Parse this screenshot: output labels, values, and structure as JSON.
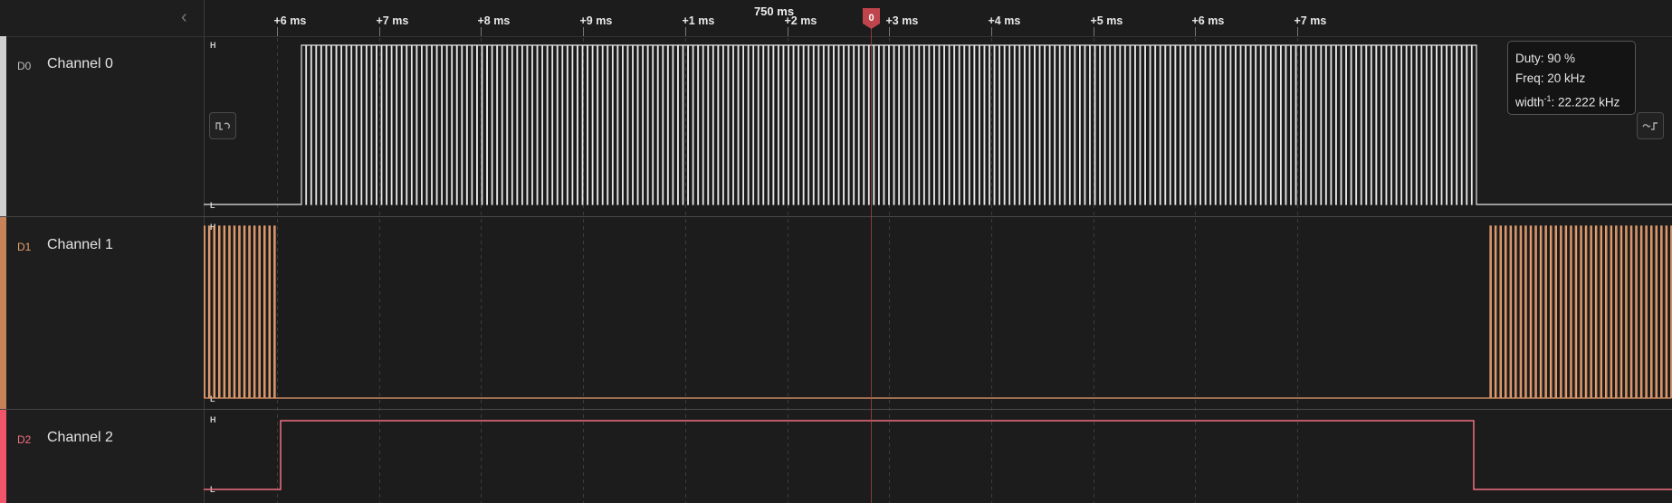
{
  "timeline": {
    "ticks": [
      "+6 ms",
      "+7 ms",
      "+8 ms",
      "+9 ms",
      "+1 ms",
      "+2 ms",
      "+3 ms",
      "+4 ms",
      "+5 ms",
      "+6 ms",
      "+7 ms"
    ],
    "center_label": "750 ms",
    "marker_label": "0"
  },
  "channels": [
    {
      "code": "D0",
      "name": "Channel 0",
      "color": "#e6e6e6",
      "bar_color": "#cfcfcf"
    },
    {
      "code": "D1",
      "name": "Channel 1",
      "color": "#e8a070",
      "bar_color": "#c8825a"
    },
    {
      "code": "D2",
      "name": "Channel 2",
      "color": "#f07080",
      "bar_color": "#f2546a"
    }
  ],
  "level_labels": {
    "high": "H",
    "low": "L"
  },
  "tooltip": {
    "duty": "Duty: 90 %",
    "freq": "Freq: 20 kHz",
    "width_prefix": "width",
    "width_sup": "-1",
    "width_value": ": 22.222 kHz"
  },
  "icons": {
    "prev_edge": "previous-edge-icon",
    "next_edge": "next-edge-icon",
    "collapse": "chevron-left-icon"
  }
}
